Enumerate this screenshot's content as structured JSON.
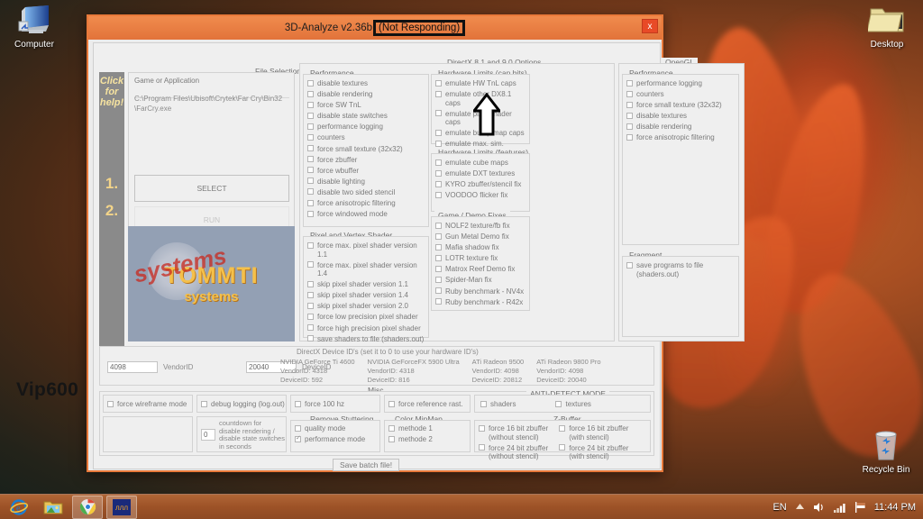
{
  "desktop": {
    "icons": [
      {
        "name": "Computer",
        "icon": "computer-icon"
      },
      {
        "name": "Desktop",
        "icon": "folder-icon"
      },
      {
        "name": "Recycle Bin",
        "icon": "recycle-bin-icon"
      }
    ],
    "watermark": "Vip600"
  },
  "taskbar": {
    "items": [
      {
        "label": "Internet Explorer",
        "icon": "internet-explorer-icon"
      },
      {
        "label": "File Explorer",
        "icon": "file-explorer-icon"
      },
      {
        "label": "Google Chrome",
        "icon": "chrome-icon"
      },
      {
        "label": "3D-Analyze",
        "icon": "app-icon"
      }
    ],
    "tray": {
      "language": "EN",
      "show_hidden": "show-hidden-icons",
      "volume": "speaker-icon",
      "network": "network-signal-icon",
      "action_center": "flag-icon",
      "clock": "11:44 PM"
    }
  },
  "window": {
    "title": "3D-Analyze v2.36b",
    "status": "(Not Responding)",
    "close_label": "x",
    "help_strip": {
      "line1": "Click",
      "line2": "for",
      "line3": "help!",
      "step1": "1.",
      "step2": "2."
    },
    "file_selection": {
      "group_label": "File Selection",
      "field_label": "Game or Application",
      "path": "C:\\Program Files\\Ubisoft\\Crytek\\Far Cry\\Bin32\\FarCry.exe",
      "select_button": "SELECT",
      "run_button": "RUN"
    },
    "logo": {
      "brand": "TOMMTI",
      "sub": "systems",
      "stamp": "systems"
    },
    "directx": {
      "group_label": "DirectX 8.1 and 9.0 Options",
      "performance": {
        "label": "Performance",
        "items": [
          {
            "label": "disable textures",
            "checked": false
          },
          {
            "label": "disable rendering",
            "checked": false
          },
          {
            "label": "force SW TnL",
            "checked": false
          },
          {
            "label": "disable state switches",
            "checked": false
          },
          {
            "label": "performance logging",
            "checked": false
          },
          {
            "label": "counters",
            "checked": false
          },
          {
            "label": "force small texture (32x32)",
            "checked": false
          },
          {
            "label": "force zbuffer",
            "checked": false
          },
          {
            "label": "force wbuffer",
            "checked": false
          },
          {
            "label": "disable lighting",
            "checked": false
          },
          {
            "label": "disable two sided stencil",
            "checked": false
          },
          {
            "label": "force anisotropic filtering",
            "checked": false
          },
          {
            "label": "force windowed mode",
            "checked": false
          }
        ]
      },
      "shader": {
        "label": "Pixel and Vertex Shader",
        "items": [
          {
            "label": "force max. pixel shader version 1.1",
            "checked": false
          },
          {
            "label": "force max. pixel shader version 1.4",
            "checked": false
          },
          {
            "label": "skip pixel shader version 1.1",
            "checked": false
          },
          {
            "label": "skip pixel shader version 1.4",
            "checked": false
          },
          {
            "label": "skip pixel shader version 2.0",
            "checked": false
          },
          {
            "label": "force low precision pixel shader",
            "checked": false
          },
          {
            "label": "force high precision pixel shader",
            "checked": false
          },
          {
            "label": "save shaders to file (shaders.out)",
            "checked": false
          }
        ]
      },
      "caps": {
        "label": "Hardware Limits (cap bits)",
        "items": [
          {
            "label": "emulate HW TnL caps",
            "checked": false
          },
          {
            "label": "emulate other DX8.1 caps",
            "checked": false
          },
          {
            "label": "emulate pixel shader caps",
            "checked": false
          },
          {
            "label": "emulate bump map caps",
            "checked": false
          },
          {
            "label": "emulate max. sim. textures",
            "checked": false
          }
        ]
      },
      "features": {
        "label": "Hardware Limits (features)",
        "items": [
          {
            "label": "emulate cube maps",
            "checked": false
          },
          {
            "label": "emulate DXT textures",
            "checked": false
          },
          {
            "label": "KYRO zbuffer/stencil fix",
            "checked": false
          },
          {
            "label": "VOODOO flicker fix",
            "checked": false
          }
        ]
      },
      "fixes": {
        "label": "Game / Demo Fixes",
        "items": [
          {
            "label": "NOLF2 texture/fb fix",
            "checked": false
          },
          {
            "label": "Gun Metal Demo fix",
            "checked": false
          },
          {
            "label": "Mafia shadow fix",
            "checked": false
          },
          {
            "label": "LOTR texture fix",
            "checked": false
          },
          {
            "label": "Matrox Reef Demo fix",
            "checked": false
          },
          {
            "label": "Spider-Man fix",
            "checked": false
          },
          {
            "label": "Ruby benchmark - NV4x",
            "checked": false
          },
          {
            "label": "Ruby benchmark - R42x",
            "checked": false
          }
        ]
      }
    },
    "opengl": {
      "group_label": "OpenGL Options",
      "performance": {
        "label": "Performance",
        "items": [
          {
            "label": "performance logging",
            "checked": false
          },
          {
            "label": "counters",
            "checked": false
          },
          {
            "label": "force small texture (32x32)",
            "checked": false
          },
          {
            "label": "disable textures",
            "checked": false
          },
          {
            "label": "disable rendering",
            "checked": false
          },
          {
            "label": "force anisotropic filtering",
            "checked": false
          }
        ]
      },
      "programs": {
        "label": "Fragment and Vertex Programs",
        "items": [
          {
            "label": "save programs to file (shaders.out)",
            "checked": false
          }
        ]
      }
    },
    "device_ids": {
      "group_label": "DirectX Device ID's (set it to 0 to use your hardware ID's)",
      "vendor_value": "4098",
      "vendor_label": "VendorID",
      "device_value": "20040",
      "device_label": "DeviceID",
      "presets": [
        {
          "name": "NVIDIA GeForce Ti 4600",
          "vendor": "VendorID: 4318",
          "device": "DeviceID: 592"
        },
        {
          "name": "NVIDIA GeForceFX 5900 Ultra",
          "vendor": "VendorID: 4318",
          "device": "DeviceID: 816"
        },
        {
          "name": "ATi Radeon 9500",
          "vendor": "VendorID: 4098",
          "device": "DeviceID: 20812"
        },
        {
          "name": "ATi Radeon 9800 Pro",
          "vendor": "VendorID: 4098",
          "device": "DeviceID: 20040"
        }
      ]
    },
    "misc": {
      "group_label": "Misc",
      "wireframe": {
        "label": "force wireframe mode",
        "checked": false
      },
      "debug_logging": {
        "label": "debug logging (log.out)",
        "checked": false
      },
      "force_100hz": {
        "label": "force 100 hz",
        "checked": false
      },
      "force_ref_rast": {
        "label": "force reference rast.",
        "checked": false
      },
      "countdown": {
        "value": "0",
        "label_line1": "countdown for",
        "label_line2": "disable rendering /",
        "label_line3": "disable state switches",
        "label_line4": "in seconds"
      },
      "remove_stuttering": {
        "label": "Remove Stuttering",
        "items": [
          {
            "label": "quality mode",
            "checked": false
          },
          {
            "label": "performance mode",
            "checked": true
          }
        ]
      },
      "color_mipmap": {
        "label": "Color MipMap",
        "items": [
          {
            "label": "methode 1",
            "checked": false
          },
          {
            "label": "methode 2",
            "checked": false
          }
        ]
      },
      "anti_detect": {
        "label": "ANTI-DETECT MODE",
        "items": [
          {
            "label": "shaders",
            "checked": false
          },
          {
            "label": "textures",
            "checked": false
          }
        ]
      },
      "zbuffer": {
        "label": "Z-Buffer",
        "items": [
          {
            "label": "force 16 bit zbuffer (without stencil)",
            "checked": false
          },
          {
            "label": "force 16 bit zbuffer (with stencil)",
            "checked": false
          },
          {
            "label": "force 24 bit zbuffer (without stencil)",
            "checked": false
          },
          {
            "label": "force 24 bit zbuffer (with stencil)",
            "checked": false
          }
        ]
      }
    },
    "save_batch_button": "Save batch file!"
  },
  "colors": {
    "window_border": "#e8793a",
    "titlebar": "#e2733a",
    "close_button": "#e84a27",
    "taskbar": "#9d5227",
    "logo_gold": "#f5c04a",
    "help_strip": "#8a8a8a"
  }
}
